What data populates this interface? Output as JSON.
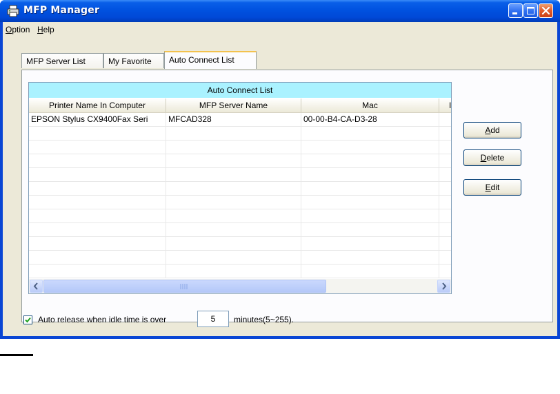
{
  "window": {
    "title": "MFP Manager",
    "accent_color": "#0a46d4",
    "app_icon": "printer-icon",
    "controls": [
      "minimize-icon",
      "maximize-icon",
      "close-icon"
    ]
  },
  "menubar": {
    "items": [
      {
        "mnemonic": "O",
        "rest": "ption"
      },
      {
        "mnemonic": "H",
        "rest": "elp"
      }
    ]
  },
  "tabs": [
    {
      "label": "MFP Server List",
      "active": false
    },
    {
      "label": "My Favorite",
      "active": false
    },
    {
      "label": "Auto Connect List",
      "active": true
    }
  ],
  "list": {
    "caption": "Auto Connect List",
    "caption_color": "#aaf2ff",
    "columns": [
      "Printer Name In Computer",
      "MFP Server Name",
      "Mac",
      "I"
    ],
    "rows": [
      [
        "EPSON Stylus CX9400Fax Seri",
        "MFCAD328",
        "00-00-B4-CA-D3-28",
        ""
      ]
    ]
  },
  "buttons": {
    "add": {
      "mnemonic": "A",
      "rest": "dd"
    },
    "delete": {
      "mnemonic": "D",
      "rest": "elete"
    },
    "edit": {
      "mnemonic": "E",
      "rest": "dit"
    }
  },
  "options": {
    "auto_release_checked": true,
    "auto_release_label": "Auto release when idle time is over",
    "idle_minutes": "5",
    "range_label": "minutes(5~255)."
  }
}
